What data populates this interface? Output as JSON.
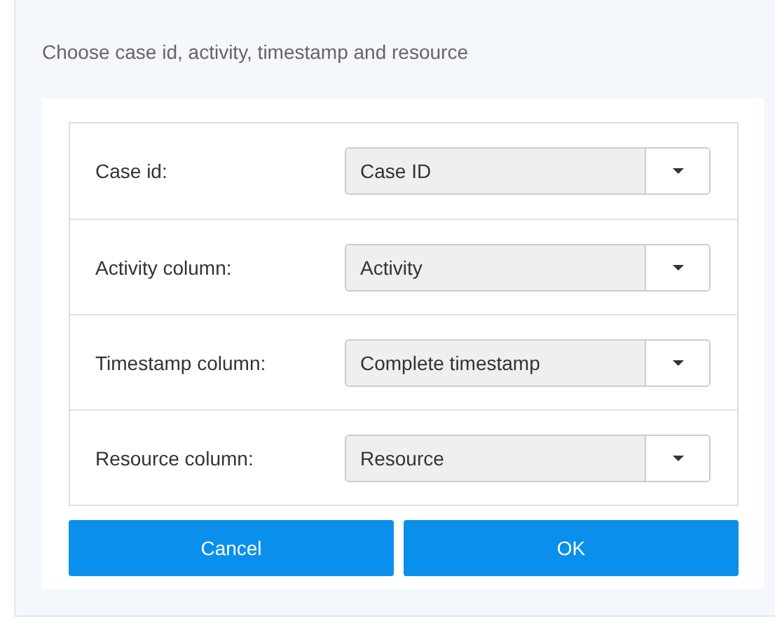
{
  "dialog": {
    "title": "Choose case id, activity, timestamp and resource"
  },
  "fields": [
    {
      "label": "Case id:",
      "value": "Case ID"
    },
    {
      "label": "Activity column:",
      "value": "Activity"
    },
    {
      "label": "Timestamp column:",
      "value": "Complete timestamp"
    },
    {
      "label": "Resource column:",
      "value": "Resource"
    }
  ],
  "buttons": [
    {
      "label": "Cancel"
    },
    {
      "label": "OK"
    }
  ]
}
